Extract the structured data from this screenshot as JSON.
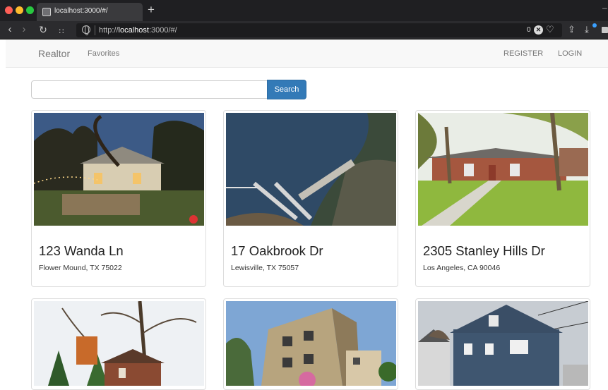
{
  "browser": {
    "tab_title": "localhost:3000/#/",
    "new_tab_label": "+",
    "url_prefix": "http://",
    "url_host": "localhost",
    "url_rest": ":3000/#/",
    "tracker_count": "0",
    "icons": [
      "back-icon",
      "forward-icon",
      "reload-icon",
      "grid-icon",
      "globe-icon",
      "shield-icon",
      "heart-icon",
      "share-icon",
      "download-icon"
    ]
  },
  "navbar": {
    "brand": "Realtor",
    "favorites": "Favorites",
    "register": "REGISTER",
    "login": "LOGIN"
  },
  "search": {
    "value": "",
    "placeholder": "",
    "button_label": "Search",
    "button_color": "#337ab7"
  },
  "listings": [
    {
      "address": "123 Wanda Ln",
      "city": "Flower Mound, TX 75022"
    },
    {
      "address": "17 Oakbrook Dr",
      "city": "Lewisville, TX 75057"
    },
    {
      "address": "2305 Stanley Hills Dr",
      "city": "Los Angeles, CA 90046"
    },
    {
      "address": "",
      "city": ""
    },
    {
      "address": "",
      "city": ""
    },
    {
      "address": "",
      "city": ""
    }
  ]
}
